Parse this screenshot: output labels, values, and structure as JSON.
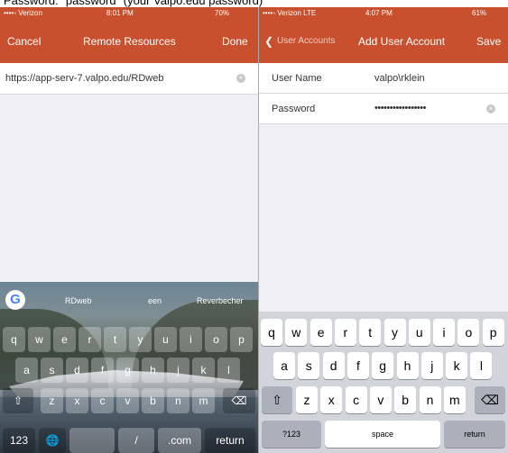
{
  "caption": "Password: \"password\" (your Valpo.edu password)",
  "left": {
    "status": {
      "carrier": "••••◦ Verizon",
      "time": "8:01 PM",
      "battery": "70%"
    },
    "nav": {
      "cancel": "Cancel",
      "title": "Remote Resources",
      "done": "Done"
    },
    "url_value": "https://app-serv-7.valpo.edu/RDweb",
    "clear_glyph": "×",
    "keyboard": {
      "suggestions": [
        "RDweb",
        "een",
        "Reverbecher"
      ],
      "row1": [
        "q",
        "w",
        "e",
        "r",
        "t",
        "y",
        "u",
        "i",
        "o",
        "p"
      ],
      "row2": [
        "a",
        "s",
        "d",
        "f",
        "g",
        "h",
        "j",
        "k",
        "l"
      ],
      "shift": "⇧",
      "row3": [
        "z",
        "x",
        "c",
        "v",
        "b",
        "n",
        "m"
      ],
      "delete": "⌫",
      "numbers": "123",
      "globe": "🌐",
      "slash": "/",
      "dotcom": ".com",
      "return": "return"
    }
  },
  "right": {
    "status": {
      "carrier": "••••◦ Verizon LTE",
      "time": "4:07 PM",
      "battery": "61%"
    },
    "nav": {
      "back": "User Accounts",
      "title": "Add User Account",
      "save": "Save"
    },
    "fields": {
      "username_label": "User Name",
      "username_value": "valpo\\rklein",
      "password_label": "Password",
      "password_value": "•••••••••••••••••"
    },
    "clear_glyph": "×",
    "keyboard": {
      "row1": [
        "q",
        "w",
        "e",
        "r",
        "t",
        "y",
        "u",
        "i",
        "o",
        "p"
      ],
      "row2": [
        "a",
        "s",
        "d",
        "f",
        "g",
        "h",
        "j",
        "k",
        "l"
      ],
      "shift": "⇧",
      "row3": [
        "z",
        "x",
        "c",
        "v",
        "b",
        "n",
        "m"
      ],
      "delete": "⌫",
      "numbers": "?123",
      "space": "space",
      "return": "return"
    }
  }
}
